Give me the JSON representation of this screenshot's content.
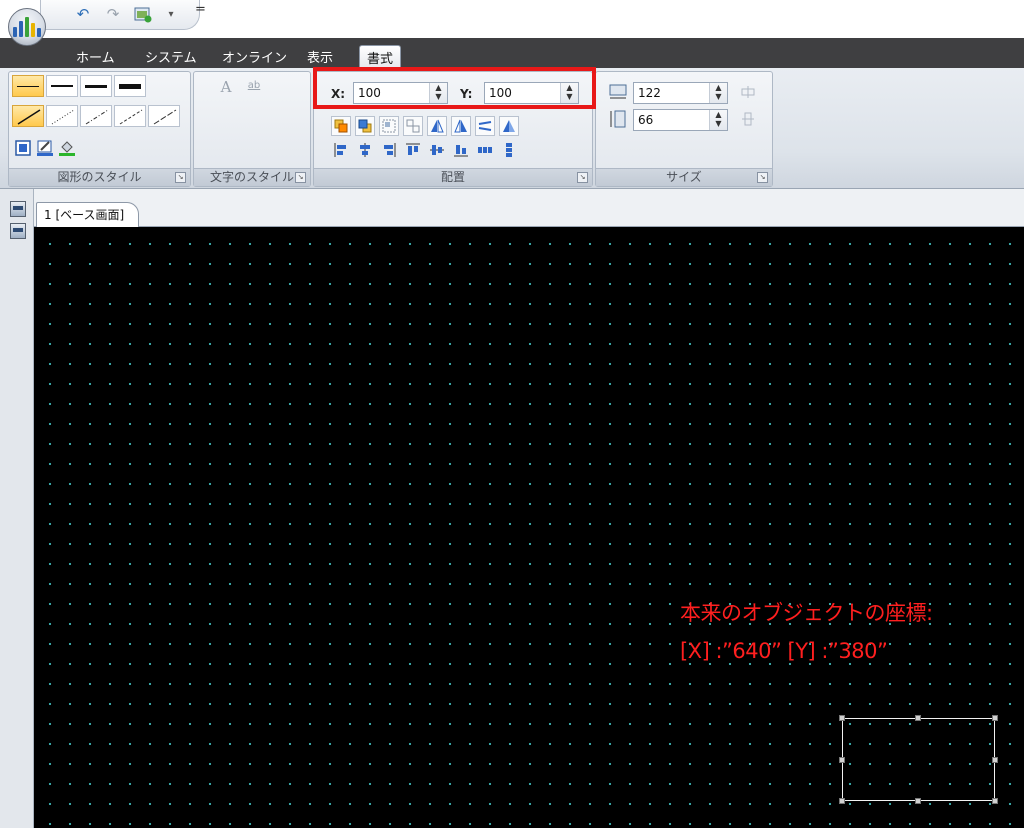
{
  "quick_access": {
    "undo_icon": "undo-icon",
    "redo_icon": "redo-icon",
    "new_icon": "new-screen-icon",
    "customize_glyph": "="
  },
  "tabs": [
    {
      "label": "ホーム",
      "active": false
    },
    {
      "label": "システム",
      "active": false
    },
    {
      "label": "オンライン",
      "active": false
    },
    {
      "label": "表示",
      "active": false
    },
    {
      "label": "書式",
      "active": true
    }
  ],
  "ribbon": {
    "shape_style": {
      "label": "図形のスタイル",
      "line_widths": [
        "thin",
        "medium",
        "thick",
        "heavy"
      ],
      "dash_styles": [
        "solid",
        "dotted",
        "dash-dot",
        "dashed",
        "long-dash"
      ],
      "style_buttons": [
        "fill-color-icon",
        "line-color-icon",
        "paint-bucket-icon"
      ]
    },
    "text_style": {
      "label": "文字のスタイル",
      "font_glyph": "A",
      "format_glyph": "ab"
    },
    "arrange": {
      "label": "配置",
      "x_label": "X:",
      "x_value": "100",
      "y_label": "Y:",
      "y_value": "100",
      "row1_icons": [
        "bring-front-icon",
        "send-back-icon",
        "group-icon",
        "ungroup-icon",
        "flip-horizontal-icon",
        "flip-vertical-icon",
        "rotate-left-icon",
        "rotate-right-icon"
      ],
      "row2_icons": [
        "align-left-icon",
        "align-center-icon",
        "align-right-icon",
        "align-top-icon",
        "align-middle-icon",
        "align-bottom-icon",
        "distribute-horizontal-icon",
        "distribute-vertical-icon"
      ]
    },
    "size": {
      "label": "サイズ",
      "width_value": "122",
      "height_value": "66"
    },
    "launcher_glyph": "↘"
  },
  "document": {
    "tab_label": "1  [ベース画面]"
  },
  "annotation": {
    "line1": "本来のオブジェクトの座標:",
    "line2": "[X] :”640”   [Y] :”380”"
  },
  "colors": {
    "annotation": "#ff1f1f",
    "highlight": "#e81818",
    "canvas_bg": "#000000",
    "grid_dot": "#3fb8b8",
    "tab_strip": "#3f3f41"
  }
}
